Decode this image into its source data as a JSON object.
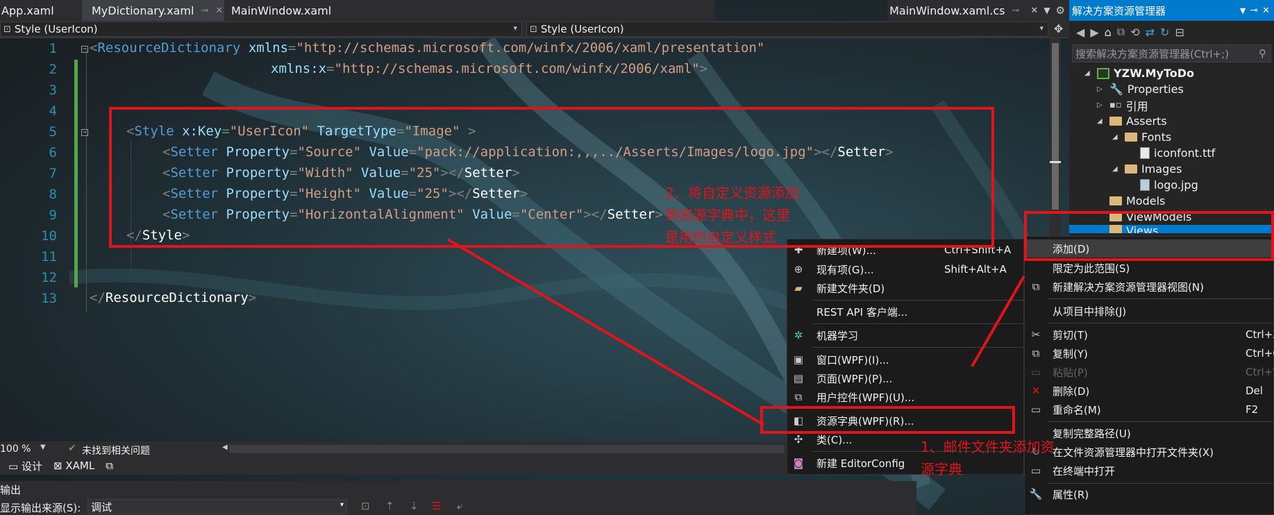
{
  "colors": {
    "accent": "#007acc",
    "annotation": "#e0141b",
    "menu_highlight": "#3e3e40"
  },
  "tabs": {
    "left": [
      {
        "label": "App.xaml"
      },
      {
        "label": "MyDictionary.xaml"
      },
      {
        "label": "MainWindow.xaml"
      }
    ],
    "right": [
      {
        "label": "MainWindow.xaml.cs"
      }
    ]
  },
  "dropdowns": {
    "left": "Style (UserIcon)",
    "right": "Style (UserIcon)"
  },
  "code": {
    "line_numbers": [
      "1",
      "2",
      "3",
      "4",
      "5",
      "6",
      "7",
      "8",
      "9",
      "10",
      "11",
      "12",
      "13"
    ],
    "l1": {
      "open": "<",
      "el": "ResourceDictionary",
      "a1": "xmlns",
      "eq": "=",
      "v1": "\"http://schemas.microsoft.com/winfx/2006/xaml/presentation\""
    },
    "l2": {
      "a1": "xmlns:x",
      "eq": "=",
      "v1": "\"http://schemas.microsoft.com/winfx/2006/xaml\"",
      "close": ">"
    },
    "l5": {
      "open": "<",
      "el": "Style",
      "a1": "x:Key",
      "v1": "\"UserIcon\"",
      "a2": "TargetType",
      "v2": "\"Image\"",
      "close": ">"
    },
    "l6": {
      "open": "<",
      "el": "Setter",
      "a1": "Property",
      "v1": "\"Source\"",
      "a2": "Value",
      "v2": "\"pack://application:,,,../Asserts/Images/logo.jpg\"",
      "close": "></",
      "el2": "Setter",
      "end": ">"
    },
    "l7": {
      "open": "<",
      "el": "Setter",
      "a1": "Property",
      "v1": "\"Width\"",
      "a2": "Value",
      "v2": "\"25\"",
      "close": "></",
      "el2": "Setter",
      "end": ">"
    },
    "l8": {
      "open": "<",
      "el": "Setter",
      "a1": "Property",
      "v1": "\"Height\"",
      "a2": "Value",
      "v2": "\"25\"",
      "close": "></",
      "el2": "Setter",
      "end": ">"
    },
    "l9": {
      "open": "<",
      "el": "Setter",
      "a1": "Property",
      "v1": "\"HorizontalAlignment\"",
      "a2": "Value",
      "v2": "\"Center\"",
      "close": "></",
      "el2": "Setter",
      "end": ">"
    },
    "l10": {
      "open": "</",
      "el": "Style",
      "close": ">"
    },
    "l13": {
      "open": "</",
      "el": "ResourceDictionary",
      "close": ">"
    }
  },
  "annotations": {
    "note2": "2、将自定义资源添加\n到资源字典中，这里\n是用的自定义样式",
    "note1": "1、邮件文件夹添加资\n源字典"
  },
  "solution_explorer": {
    "title": "解决方案资源管理器",
    "search_placeholder": "搜索解决方案资源管理器(Ctrl+;)",
    "items": [
      {
        "label": "YZW.MyToDo",
        "icon": "project-icon"
      },
      {
        "label": "Properties",
        "icon": "wrench-icon"
      },
      {
        "label": "引用",
        "icon": "references-icon"
      },
      {
        "label": "Asserts",
        "icon": "folder-icon"
      },
      {
        "label": "Fonts",
        "icon": "folder-icon"
      },
      {
        "label": "iconfont.ttf",
        "icon": "file-icon"
      },
      {
        "label": "Images",
        "icon": "folder-icon"
      },
      {
        "label": "logo.jpg",
        "icon": "image-file-icon"
      },
      {
        "label": "Models",
        "icon": "folder-icon"
      },
      {
        "label": "ViewModels",
        "icon": "folder-icon"
      },
      {
        "label": "Views",
        "icon": "folder-icon"
      }
    ]
  },
  "submenu": {
    "items": [
      {
        "label": "新建项(W)...",
        "shortcut": "Ctrl+Shift+A"
      },
      {
        "label": "现有项(G)...",
        "shortcut": "Shift+Alt+A"
      },
      {
        "label": "新建文件夹(D)",
        "shortcut": ""
      },
      {
        "label": "REST API 客户端...",
        "shortcut": ""
      },
      {
        "label": "机器学习",
        "shortcut": ""
      },
      {
        "label": "窗口(WPF)(I)...",
        "shortcut": ""
      },
      {
        "label": "页面(WPF)(P)...",
        "shortcut": ""
      },
      {
        "label": "用户控件(WPF)(U)...",
        "shortcut": ""
      },
      {
        "label": "资源字典(WPF)(R)...",
        "shortcut": ""
      },
      {
        "label": "类(C)...",
        "shortcut": ""
      },
      {
        "label": "新建 EditorConfig",
        "shortcut": ""
      }
    ]
  },
  "context_menu": {
    "items": [
      {
        "label": "添加(D)",
        "shortcut": ""
      },
      {
        "label": "限定为此范围(S)",
        "shortcut": ""
      },
      {
        "label": "新建解决方案资源管理器视图(N)",
        "shortcut": ""
      },
      {
        "label": "从项目中排除(J)",
        "shortcut": ""
      },
      {
        "label": "剪切(T)",
        "shortcut": "Ctrl+X"
      },
      {
        "label": "复制(Y)",
        "shortcut": "Ctrl+C"
      },
      {
        "label": "粘贴(P)",
        "shortcut": "Ctrl+V"
      },
      {
        "label": "删除(D)",
        "shortcut": "Del"
      },
      {
        "label": "重命名(M)",
        "shortcut": "F2"
      },
      {
        "label": "复制完整路径(U)",
        "shortcut": ""
      },
      {
        "label": "在文件资源管理器中打开文件夹(X)",
        "shortcut": ""
      },
      {
        "label": "在终端中打开",
        "shortcut": ""
      },
      {
        "label": "属性(R)",
        "shortcut": ""
      }
    ]
  },
  "status": {
    "zoom": "100 %",
    "issues": "未找到相关问题"
  },
  "view_tabs": {
    "design": "设计",
    "xaml": "XAML"
  },
  "output": {
    "title": "输出",
    "source_label": "显示输出来源(S):",
    "source_value": "调试"
  }
}
